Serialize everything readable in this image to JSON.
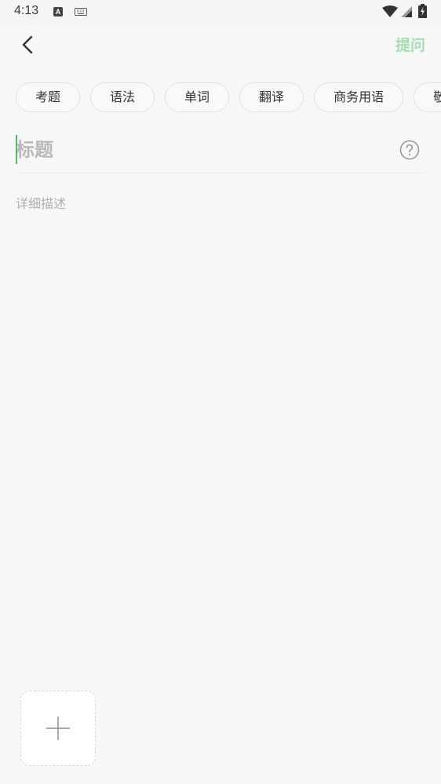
{
  "status_bar": {
    "time": "4:13",
    "a_icon": "A"
  },
  "header": {
    "ask_label": "提问"
  },
  "categories": [
    "考题",
    "语法",
    "单词",
    "翻译",
    "商务用语",
    "敬语"
  ],
  "form": {
    "title_placeholder": "标题",
    "description_placeholder": "详细描述"
  },
  "colors": {
    "accent": "#a6dcae",
    "caret": "#5ab56a",
    "background": "#f7f7f7"
  },
  "icons": [
    "back-arrow-icon",
    "help-icon",
    "plus-icon",
    "wifi-icon",
    "signal-icon",
    "battery-icon",
    "keyboard-icon"
  ]
}
